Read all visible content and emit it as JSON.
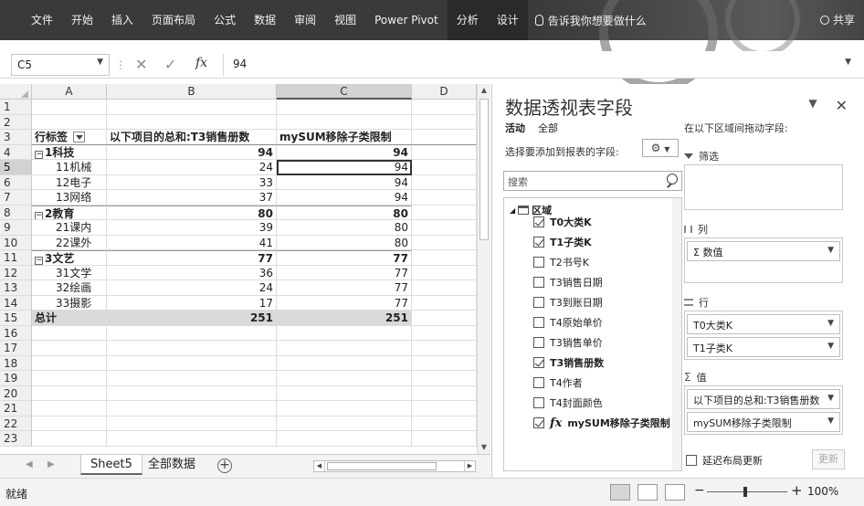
{
  "ribbon": {
    "tabs": [
      "文件",
      "开始",
      "插入",
      "页面布局",
      "公式",
      "数据",
      "审阅",
      "视图",
      "Power Pivot",
      "分析",
      "设计"
    ],
    "tellme": "告诉我你想要做什么",
    "share": "共享"
  },
  "formula_bar": {
    "name_box": "C5",
    "fx": "fx",
    "value": "94"
  },
  "columns": [
    "A",
    "B",
    "C",
    "D"
  ],
  "row_numbers": [
    "1",
    "2",
    "3",
    "4",
    "5",
    "6",
    "7",
    "8",
    "9",
    "10",
    "11",
    "12",
    "13",
    "14",
    "15",
    "16",
    "17",
    "18",
    "19",
    "20",
    "21",
    "22",
    "23"
  ],
  "pivot": {
    "header": [
      "行标签",
      "以下项目的总和:T3销售册数",
      "mySUM移除子类限制"
    ],
    "rows": [
      {
        "label": "1科技",
        "b": "94",
        "c": "94",
        "level": "group"
      },
      {
        "label": "11机械",
        "b": "24",
        "c": "94",
        "level": "item"
      },
      {
        "label": "12电子",
        "b": "33",
        "c": "94",
        "level": "item"
      },
      {
        "label": "13网络",
        "b": "37",
        "c": "94",
        "level": "item"
      },
      {
        "label": "2教育",
        "b": "80",
        "c": "80",
        "level": "group"
      },
      {
        "label": "21课内",
        "b": "39",
        "c": "80",
        "level": "item"
      },
      {
        "label": "22课外",
        "b": "41",
        "c": "80",
        "level": "item"
      },
      {
        "label": "3文艺",
        "b": "77",
        "c": "77",
        "level": "group"
      },
      {
        "label": "31文学",
        "b": "36",
        "c": "77",
        "level": "item"
      },
      {
        "label": "32绘画",
        "b": "24",
        "c": "77",
        "level": "item"
      },
      {
        "label": "33摄影",
        "b": "17",
        "c": "77",
        "level": "item"
      }
    ],
    "total": {
      "label": "总计",
      "b": "251",
      "c": "251"
    }
  },
  "sheet_tabs": [
    "Sheet5",
    "全部数据"
  ],
  "status": {
    "ready": "就绪",
    "zoom": "100%"
  },
  "panel": {
    "title": "数据透视表字段",
    "tab_active": "活动",
    "tab_all": "全部",
    "hint_fields": "选择要添加到报表的字段:",
    "hint_areas": "在以下区域间拖动字段:",
    "search_placeholder": "搜索",
    "table_name": "区域",
    "fields": [
      {
        "name": "T0大类K",
        "checked": true
      },
      {
        "name": "T1子类K",
        "checked": true
      },
      {
        "name": "T2书号K",
        "checked": false
      },
      {
        "name": "T3销售日期",
        "checked": false
      },
      {
        "name": "T3到账日期",
        "checked": false
      },
      {
        "name": "T4原始单价",
        "checked": false
      },
      {
        "name": "T3销售单价",
        "checked": false
      },
      {
        "name": "T3销售册数",
        "checked": true
      },
      {
        "name": "T4作者",
        "checked": false
      },
      {
        "name": "T4封面颜色",
        "checked": false
      },
      {
        "name": "mySUM移除子类限制",
        "checked": true
      }
    ],
    "areas": {
      "filters_label": "筛选",
      "columns_label": "列",
      "columns_items": [
        "Σ 数值"
      ],
      "rows_label": "行",
      "rows_items": [
        "T0大类K",
        "T1子类K"
      ],
      "values_label": "值",
      "values_items": [
        "以下项目的总和:T3销售册数",
        "mySUM移除子类限制"
      ]
    },
    "defer_label": "延迟布局更新",
    "update_label": "更新"
  }
}
